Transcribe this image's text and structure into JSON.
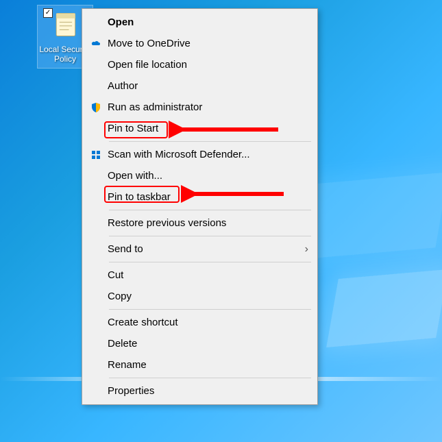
{
  "desktop_icon": {
    "label": "Local Security Policy",
    "checked": true
  },
  "context_menu": {
    "items": [
      {
        "label": "Open",
        "bold": true,
        "icon": ""
      },
      {
        "label": "Move to OneDrive",
        "icon": "cloud"
      },
      {
        "label": "Open file location",
        "icon": ""
      },
      {
        "label": "Author",
        "icon": ""
      },
      {
        "label": "Run as administrator",
        "icon": "shield"
      },
      {
        "label": "Pin to Start",
        "icon": ""
      },
      {
        "sep": true
      },
      {
        "label": "Scan with Microsoft Defender...",
        "icon": "defender"
      },
      {
        "label": "Open with...",
        "icon": ""
      },
      {
        "label": "Pin to taskbar",
        "icon": ""
      },
      {
        "sep": true
      },
      {
        "label": "Restore previous versions",
        "icon": ""
      },
      {
        "sep": true
      },
      {
        "label": "Send to",
        "icon": "",
        "sub": true
      },
      {
        "sep": true
      },
      {
        "label": "Cut",
        "icon": ""
      },
      {
        "label": "Copy",
        "icon": ""
      },
      {
        "sep": true
      },
      {
        "label": "Create shortcut",
        "icon": ""
      },
      {
        "label": "Delete",
        "icon": ""
      },
      {
        "label": "Rename",
        "icon": ""
      },
      {
        "sep": true
      },
      {
        "label": "Properties",
        "icon": ""
      }
    ]
  }
}
